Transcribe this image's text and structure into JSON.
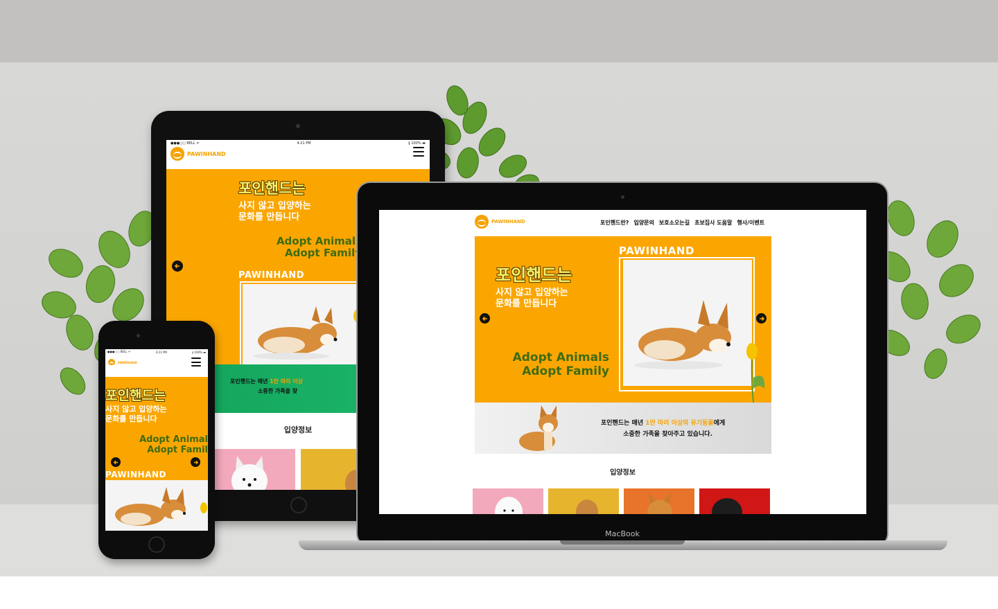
{
  "scene": {
    "laptop_label": "MacBook",
    "colors": {
      "accent": "#f5a300",
      "hero_bg": "#fba600",
      "adopt_text": "#3f6b12",
      "title_yellow": "#f7f26a"
    }
  },
  "status": {
    "carrier": "●●●○○ BELL ᯤ",
    "time": "4:21 PM",
    "battery": "∦ 100% ▬"
  },
  "brand": "PAWINHAND",
  "nav": [
    "포인핸드란?",
    "입양문의",
    "보호소오는길",
    "초보집사 도움말",
    "행사/이벤트"
  ],
  "hero": {
    "title": "포인핸드는",
    "sub_line1": "사지 않고 입양하는",
    "sub_line2": "문화를 만듭니다",
    "adopt_line1": "Adopt Animals",
    "adopt_line2": "Adopt Family",
    "photo_label": "PAWINHAND"
  },
  "banner": {
    "pre": "포인핸드는 매년 ",
    "highlight": "1만 마리 이상의 유기동물",
    "post": "에게",
    "line2": "소중한 가족을 찾아주고 있습니다."
  },
  "tablet_banner": {
    "pre": "포인핸드는 매년 ",
    "highlight": "1만 마리 이상",
    "line2": "소중한 가족을 찾"
  },
  "tablet_hero": {
    "adopt_line1": "Adopt Animals",
    "adopt_line2": "Adopt Family"
  },
  "phone_hero": {
    "adopt_line1": "Adopt Animal",
    "adopt_line2": "Adopt Famil"
  },
  "section": {
    "adoption_info": "입양정보"
  },
  "icons": [
    "arrow-left-icon",
    "arrow-right-icon",
    "hamburger-menu-icon",
    "pawinhand-logo-icon",
    "camera-icon",
    "home-button-icon"
  ]
}
